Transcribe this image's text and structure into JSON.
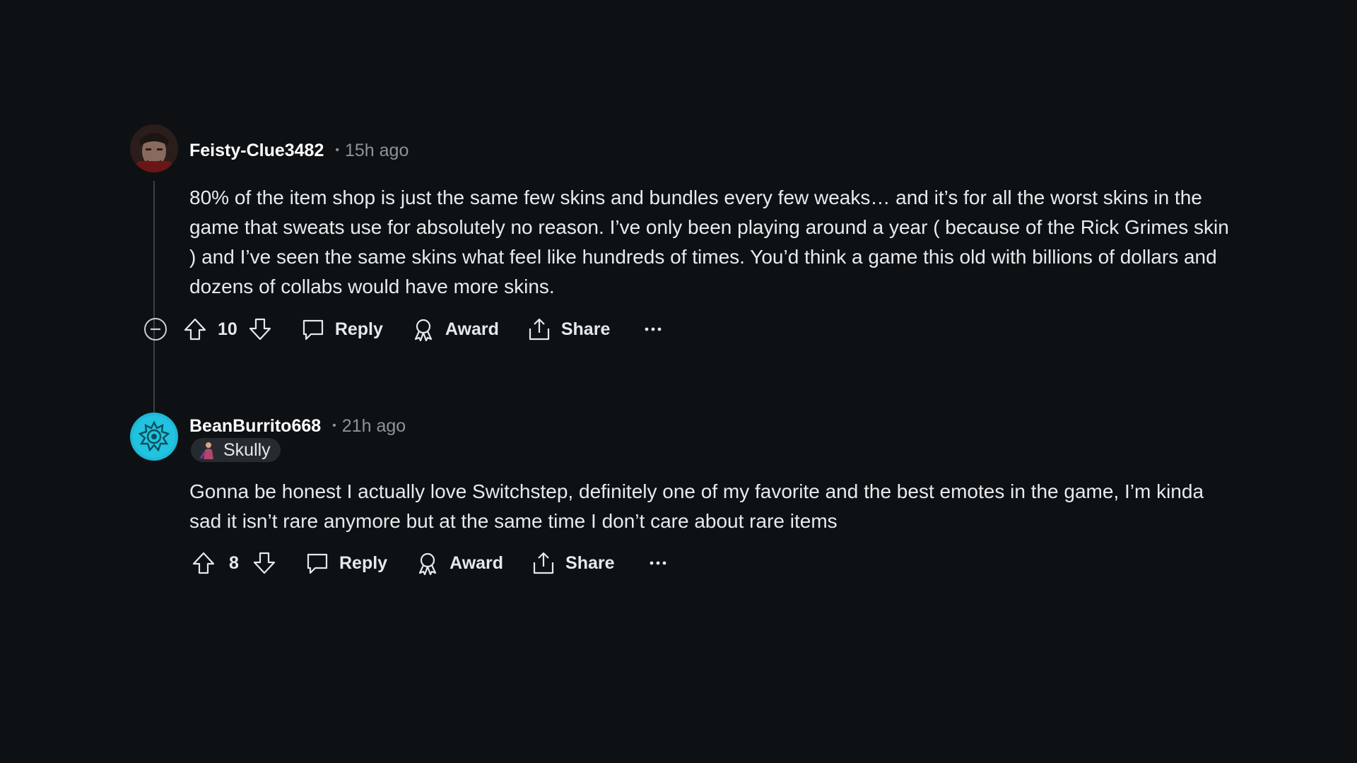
{
  "comments": [
    {
      "username": "Feisty-Clue3482",
      "separator": "•",
      "time": "15h ago",
      "body": "80% of the item shop is just the same few skins and bundles every few weaks… and it’s for all the worst skins in the game that sweats use for absolutely no reason. I’ve only been playing around a year ( because of the Rick Grimes skin ) and I’ve seen the same skins what feel like hundreds of times. You’d think a game this old with billions of dollars and dozens of collabs would have more skins.",
      "score": "10",
      "reply_label": "Reply",
      "award_label": "Award",
      "share_label": "Share",
      "more_label": "···"
    },
    {
      "username": "BeanBurrito668",
      "separator": "•",
      "time": "21h ago",
      "flair": "Skully",
      "body": "Gonna be honest I actually love Switchstep, definitely one of my favorite and the best emotes in the game, I’m kinda sad it isn’t rare anymore but at the same time I don’t care about rare items",
      "score": "8",
      "reply_label": "Reply",
      "award_label": "Award",
      "share_label": "Share",
      "more_label": "···"
    }
  ],
  "colors": {
    "background": "#0e1113",
    "text": "#e8ebed",
    "muted": "#8c9499",
    "avatar_accent": "#1fb8d6"
  },
  "icons": [
    "collapse-icon",
    "upvote-icon",
    "downvote-icon",
    "reply-icon",
    "award-icon",
    "share-icon",
    "more-icon"
  ]
}
